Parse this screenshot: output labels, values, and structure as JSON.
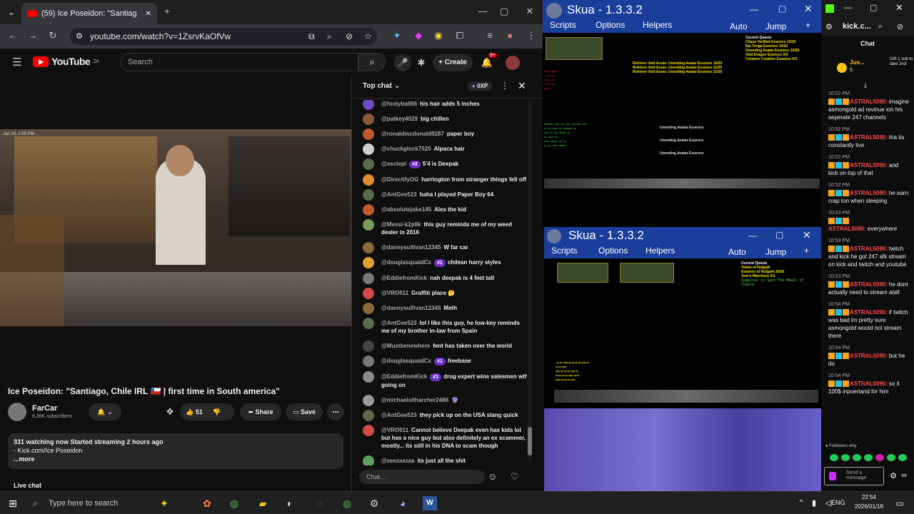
{
  "browser": {
    "tab_title": "(59) Ice Poseidon: \"Santiag",
    "url": "youtube.com/watch?v=1ZsrvKaOfVw"
  },
  "youtube": {
    "logo_text": "YouTube",
    "logo_region": "ZA",
    "search_placeholder": "Search",
    "create_label": "Create",
    "notif_count": "9+",
    "video_timestamp": "Jan 18, 2:55 PM",
    "video_title": "Ice Poseidon: \"Santiago, Chile IRL 🇨🇱 | first time in South america\"",
    "channel_name": "FarCar",
    "subscribers": "8.38K subscribers",
    "like_count": "51",
    "share_label": "Share",
    "save_label": "Save",
    "desc_line1": "331 watching now  Started streaming 2 hours ago",
    "desc_line2": "- Kick.com/Ice Poseidon",
    "desc_more": "...more",
    "live_chat_label": "Live chat"
  },
  "chat": {
    "header": "Top chat",
    "xp_badge": "0XP",
    "input_placeholder": "Chat...",
    "messages": [
      {
        "author": "@footyball66",
        "text": "his hair adds 5 inches",
        "badge": ""
      },
      {
        "author": "@patkey4029",
        "text": "big chillen",
        "badge": ""
      },
      {
        "author": "@ronaldmcdonald9287",
        "text": "paper boy",
        "badge": ""
      },
      {
        "author": "@chuckglock7520",
        "text": "Alpaca hair",
        "badge": ""
      },
      {
        "author": "@asclepi",
        "text": "5'4 is Deepak",
        "badge": "#2"
      },
      {
        "author": "@DirectifyOG",
        "text": "harrington from stranger things fell off",
        "badge": ""
      },
      {
        "author": "@AntGee523",
        "text": "haha I played Paper Boy 64",
        "badge": ""
      },
      {
        "author": "@absolutejoke145",
        "text": "Alex the kid",
        "badge": ""
      },
      {
        "author": "@Messi-k2p6k",
        "text": "this guy reminds me of my weed dealer in 2016",
        "badge": ""
      },
      {
        "author": "@dannysullivan12345",
        "text": "W far car",
        "badge": ""
      },
      {
        "author": "@douglasquaidCx",
        "text": "chilean harry styles",
        "badge": "#1"
      },
      {
        "author": "@EddiefromKick",
        "text": "nah deepak is 4 feet tall",
        "badge": ""
      },
      {
        "author": "@VRO911",
        "text": "Graffiti place 🤔",
        "badge": ""
      },
      {
        "author": "@dannysullivan12345",
        "text": "Meth",
        "badge": ""
      },
      {
        "author": "@AntGee523",
        "text": "lol I like this guy, he low-key reminds me of my brother in-law from Spain",
        "badge": ""
      },
      {
        "author": "@Mustbenewhere",
        "text": "fent has taken over the world",
        "badge": ""
      },
      {
        "author": "@douglasquaidCx",
        "text": "freebase",
        "badge": "#1"
      },
      {
        "author": "@EddiefromKick",
        "text": "drug expert wine salesmen wtf going on",
        "badge": "#1"
      },
      {
        "author": "@michaelsitharcher2486",
        "text": "🔮",
        "badge": ""
      },
      {
        "author": "@AntGee523",
        "text": "they pick up on the USA slang quick",
        "badge": ""
      },
      {
        "author": "@VRO911",
        "text": "Cannot believe Deepak even has kids lol but has a nice guy but also definitely an ex scammer, mostly... its still in his DNA to scam though",
        "badge": ""
      },
      {
        "author": "@zeezaazaa",
        "text": "its just all the shit",
        "badge": ""
      }
    ]
  },
  "skua1": {
    "title": "Skua - 1.3.3.2",
    "menu": [
      "Scripts",
      "Options",
      "Helpers",
      "Auto",
      "Jump"
    ],
    "quest_title": "Current Quests",
    "quests": [
      "Chaos Verified Essence 10/20",
      "Dai Tenga Essence 10/20",
      "Unending Avatar Essence 10/20",
      "Void Dragon Essence 0/3",
      "Creature Creation Essence 9/3"
    ],
    "yellow_lines": [
      "Retrieve Void Auras: Unending Avatar Essence 10/20",
      "Retrieve Void Auras: Unending Avatar Essence 11/20",
      "Retrieve Void Auras: Unending Avatar Essence 12/20"
    ],
    "targets": [
      "Unending Avatar Essence",
      "Unending Avatar Essence",
      "Unending Avatar Essence"
    ]
  },
  "skua2": {
    "title": "Skua - 1.3.3.2",
    "menu": [
      "Scripts",
      "Options",
      "Helpers",
      "Auto",
      "Jump"
    ],
    "quest_title": "Current Quests",
    "quests": [
      "Totem of Nulgath",
      "Essence of Nulgath 20/20",
      "Tear's Warsleyer 0/1",
      "Supplies to Spin The Wheel of Chance"
    ]
  },
  "kick": {
    "url": "kick.c...",
    "chat_label": "Chat",
    "gift_user": "Jus...",
    "gift_count": "5",
    "gift_text": "Gift 1 sub to take 2nd",
    "messages": [
      {
        "time": "10:52 PM",
        "user": "ASTRAL5090:",
        "text": "imagine asmongold ad revinue ion his seperate 247 channels"
      },
      {
        "time": "10:52 PM",
        "user": "ASTRAL5090:",
        "text": "tha tis constantly live"
      },
      {
        "time": "10:52 PM",
        "user": "ASTRAL5090:",
        "text": "and kick on top of that"
      },
      {
        "time": "10:52 PM",
        "user": "ASTRAL5090:",
        "text": "he earn crap ton when sleeping"
      },
      {
        "time": "10:53 PM",
        "user": "ASTRAL5090:",
        "text": "everywhere"
      },
      {
        "time": "10:53 PM",
        "user": "ASTRAL5090:",
        "text": "twitch and kick he got 247 afk stream on kick and twitch and youtube"
      },
      {
        "time": "10:53 PM",
        "user": "ASTRAL5090:",
        "text": "he dont actually need to stream atall"
      },
      {
        "time": "10:54 PM",
        "user": "ASTRAL5090:",
        "text": "if twitch was bad im pretty sure asmongold would not stream there"
      },
      {
        "time": "10:54 PM",
        "user": "ASTRAL5090:",
        "text": "but he do"
      },
      {
        "time": "10:54 PM",
        "user": "ASTRAL5090:",
        "text": "so it 100$ inpoertand for him"
      }
    ],
    "followers_only": "Followers only",
    "send_placeholder": "Send a message"
  },
  "taskbar": {
    "search_placeholder": "Type here to search",
    "lang": "ENG",
    "time": "22:54",
    "date": "2026/01/18"
  }
}
